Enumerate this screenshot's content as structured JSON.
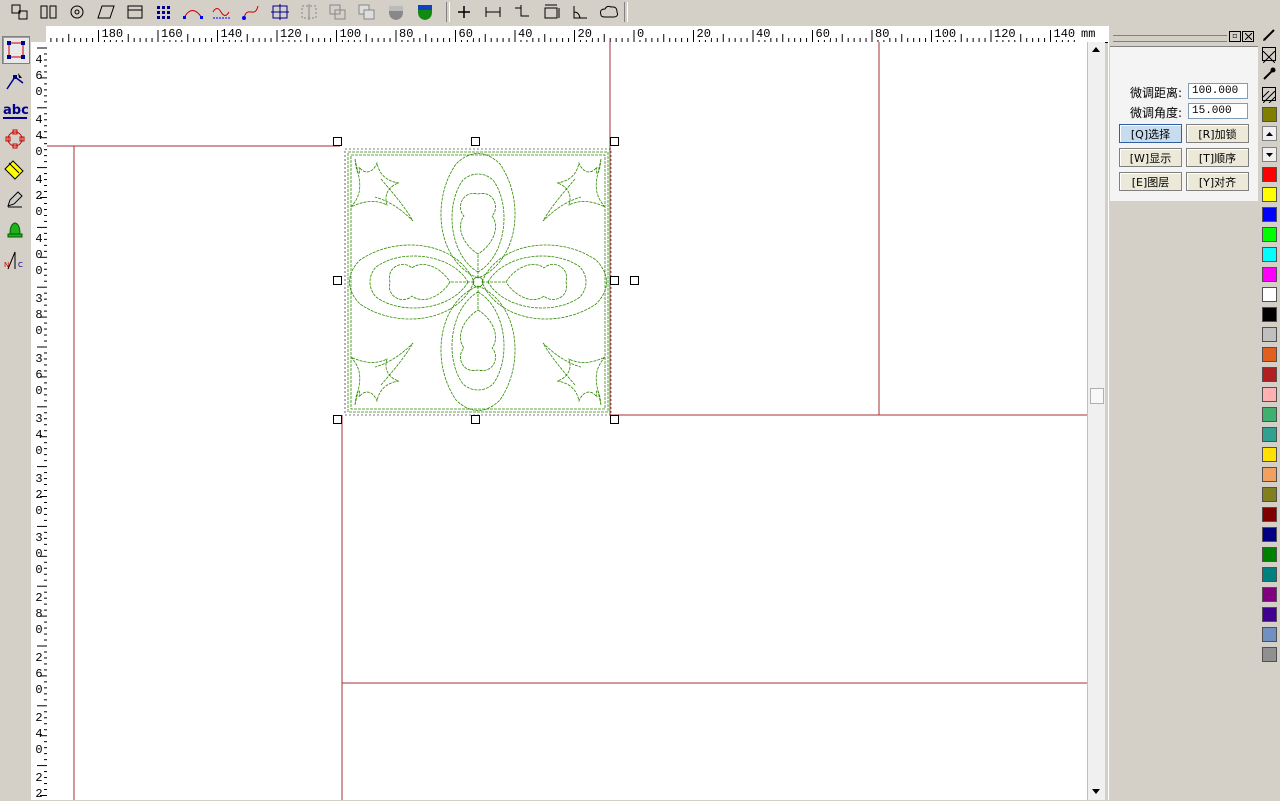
{
  "toolbar": {
    "left_tools": [
      "node-edit-icon",
      "mirror-icon",
      "gear-shape-icon",
      "parallelogram-icon",
      "rectangle-frame-icon",
      "grid-array-icon",
      "curve-node-icon",
      "wave-curve-icon",
      "spline-tool-icon",
      "crop-frame-icon",
      "dotted-frame-icon",
      "overlap-frame-icon",
      "merge-frame-icon",
      "gray-shield-icon",
      "green-shield-icon"
    ],
    "right_tools": [
      "plus-icon",
      "measure-icon",
      "step-icon",
      "size-frame-icon",
      "angle-icon",
      "cloud-icon"
    ]
  },
  "ruler": {
    "unit": "mm",
    "h_labels": [
      "180",
      "160",
      "140",
      "120",
      "100",
      "80",
      "60",
      "40",
      "20",
      "0",
      "20",
      "40",
      "60",
      "80",
      "100",
      "120",
      "140"
    ],
    "v_labels": [
      [
        "4",
        "6",
        "0"
      ],
      [
        "4",
        "4",
        "0"
      ],
      [
        "4",
        "2",
        "0"
      ],
      [
        "4",
        "0",
        "0"
      ],
      [
        "3",
        "8",
        "0"
      ],
      [
        "3",
        "6",
        "0"
      ],
      [
        "3",
        "4",
        "0"
      ],
      [
        "3",
        "2",
        "0"
      ],
      [
        "3",
        "0",
        "0"
      ],
      [
        "2",
        "8",
        "0"
      ],
      [
        "2",
        "6",
        "0"
      ],
      [
        "2",
        "4",
        "0"
      ],
      [
        "2",
        "2"
      ]
    ]
  },
  "left_tools": [
    "select-rect-icon",
    "node-tool-icon",
    "text-tool-icon",
    "circle-target-icon",
    "fill-bucket-icon",
    "pen-edit-icon",
    "bell-tool-icon",
    "stitch-param-icon"
  ],
  "panel": {
    "micro_distance_label": "微调距离:",
    "micro_distance_value": "100.000",
    "micro_angle_label": "微调角度:",
    "micro_angle_value": "15.000",
    "buttons": [
      "[Q]选择",
      "[R]加锁",
      "[W]显示",
      "[T]顺序",
      "[E]图层",
      "[Y]对齐"
    ]
  },
  "palette": {
    "top_tools": [
      "pencil-icon",
      "x-box-icon",
      "eyedropper-icon",
      "pattern-fill-icon"
    ],
    "top_color": "#808000",
    "colors": [
      "#ff0000",
      "#ffff00",
      "#0000ff",
      "#00ff00",
      "#00ffff",
      "#ff00ff",
      "#ffffff",
      "#000000",
      "#c0c0c0",
      "#e06020",
      "#b02020",
      "#ffb0b0",
      "#40b070",
      "#30a090",
      "#ffe000",
      "#f0a060",
      "#808020",
      "#800000",
      "#000080",
      "#008000",
      "#008080",
      "#800080",
      "#400090",
      "#7090c0",
      "#909090"
    ]
  },
  "colors": {
    "guide_line": "#a03030",
    "stitch_line": "#2e8b00",
    "canvas_bg": "#ffffff",
    "panel_active_btn": "#c8dcf0"
  }
}
